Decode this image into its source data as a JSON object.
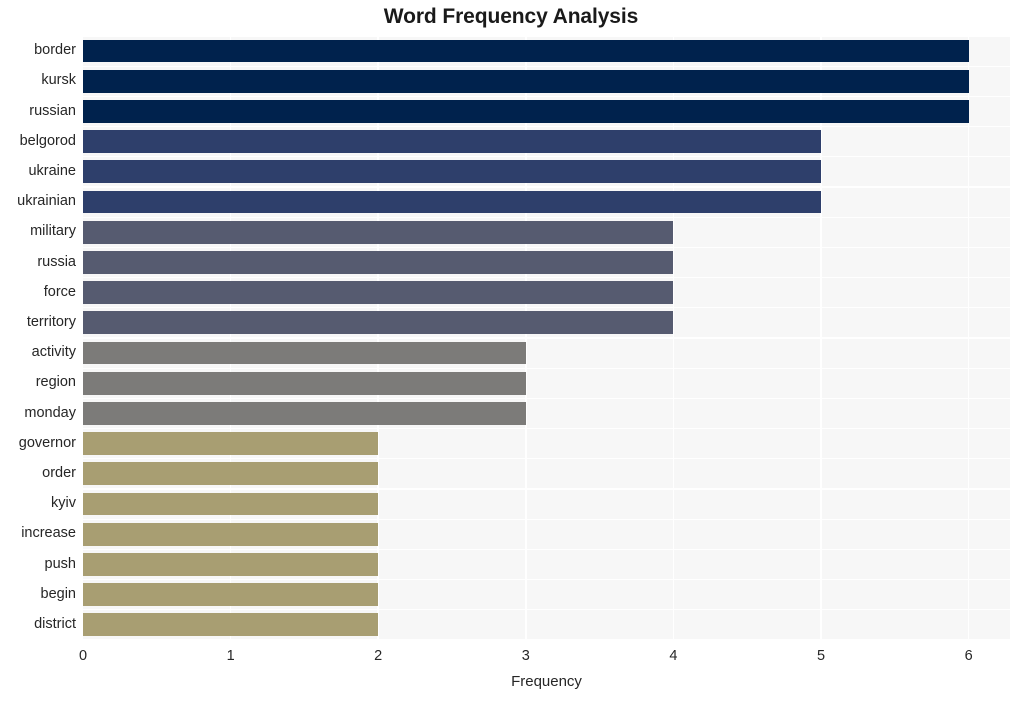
{
  "chart_data": {
    "type": "bar",
    "orientation": "horizontal",
    "title": "Word Frequency Analysis",
    "xlabel": "Frequency",
    "ylabel": "",
    "xlim": [
      0,
      6.28
    ],
    "xticks": [
      0,
      1,
      2,
      3,
      4,
      5,
      6
    ],
    "xtick_labels": [
      "0",
      "1",
      "2",
      "3",
      "4",
      "5",
      "6"
    ],
    "grid": true,
    "legend": null,
    "categories": [
      "border",
      "kursk",
      "russian",
      "belgorod",
      "ukraine",
      "ukrainian",
      "military",
      "russia",
      "force",
      "territory",
      "activity",
      "region",
      "monday",
      "governor",
      "order",
      "kyiv",
      "increase",
      "push",
      "begin",
      "district"
    ],
    "values": [
      6,
      6,
      6,
      5,
      5,
      5,
      4,
      4,
      4,
      4,
      3,
      3,
      3,
      2,
      2,
      2,
      2,
      2,
      2,
      2
    ],
    "bar_colors": [
      "#00224d",
      "#00224d",
      "#00224d",
      "#2e3f6b",
      "#2e3f6b",
      "#2e3f6b",
      "#565b70",
      "#565b70",
      "#565b70",
      "#565b70",
      "#7c7b79",
      "#7c7b79",
      "#7c7b79",
      "#a89e72",
      "#a89e72",
      "#a89e72",
      "#a89e72",
      "#a89e72",
      "#a89e72",
      "#a89e72"
    ],
    "palette": {
      "navy": "#00224d",
      "blue": "#2e3f6b",
      "slate": "#565b70",
      "gray": "#7c7b79",
      "khaki": "#a89e72",
      "plot_background": "#f7f7f7",
      "grid_color": "#ffffff",
      "figure_background": "#ffffff",
      "text_color": "#262626"
    }
  }
}
